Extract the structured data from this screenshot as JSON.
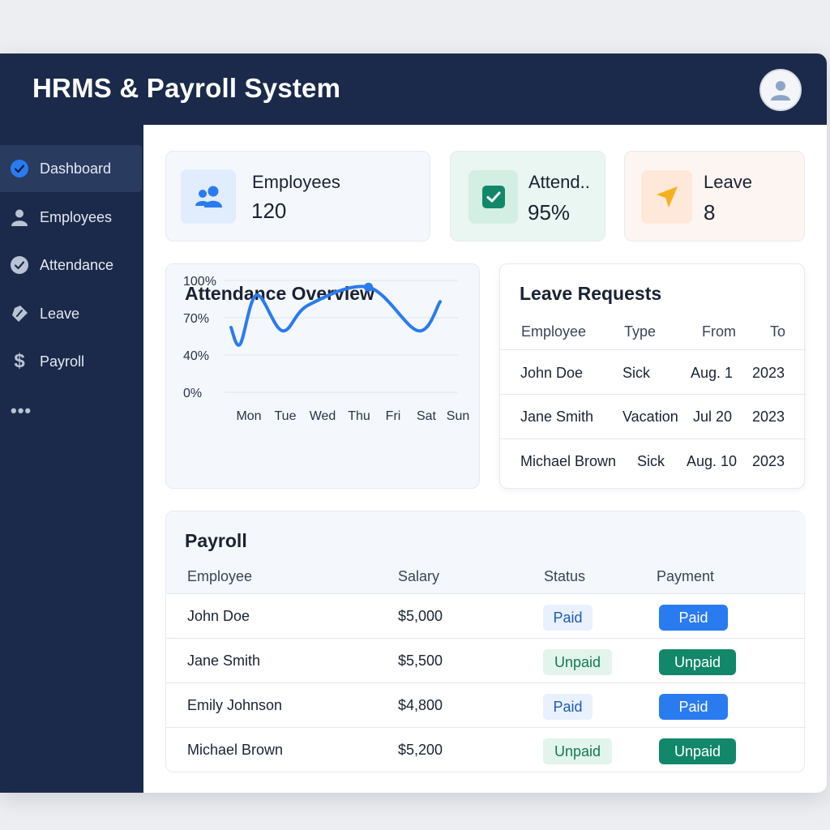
{
  "app": {
    "title": "HRMS & Payroll System"
  },
  "sidebar": {
    "items": [
      {
        "label": "Dashboard",
        "icon": "check-circle-icon",
        "active": true
      },
      {
        "label": "Employees",
        "icon": "user-icon"
      },
      {
        "label": "Attendance",
        "icon": "check-circle-icon"
      },
      {
        "label": "Leave",
        "icon": "tag-icon"
      },
      {
        "label": "Payroll",
        "icon": "dollar-icon"
      }
    ],
    "more": "•••"
  },
  "stats": [
    {
      "label": "Employees",
      "value": "120",
      "icon": "users-icon"
    },
    {
      "label": "Attend..",
      "value": "95%",
      "icon": "checkbox-icon"
    },
    {
      "label": "Leave",
      "value": "8",
      "icon": "send-icon"
    }
  ],
  "attendance": {
    "title": "Attendance Overview",
    "y_ticks": [
      "100%",
      "70%",
      "40%",
      "0%"
    ],
    "x_ticks": [
      "Mon",
      "Tue",
      "Wed",
      "Thu",
      "Fri",
      "Sat",
      "Sun"
    ]
  },
  "chart_data": {
    "type": "line",
    "title": "Attendance Overview",
    "xlabel": "",
    "ylabel": "",
    "categories": [
      "Mon",
      "Tue",
      "Wed",
      "Thu",
      "Fri",
      "Sat",
      "Sun"
    ],
    "y_tick_labels": [
      "100%",
      "70%",
      "40%",
      "0%"
    ],
    "grid": true,
    "series": [
      {
        "values": [
          58,
          43,
          87,
          55,
          78,
          94,
          55,
          81
        ],
        "x_positions": [
          0,
          0.25,
          0.7,
          1.4,
          2.1,
          3.8,
          5.3,
          6.0
        ]
      }
    ],
    "highlight_point": {
      "category": "Fri",
      "value": 94
    },
    "color": "#2a7bf0"
  },
  "leave_requests": {
    "title": "Leave Requests",
    "columns": [
      "Employee",
      "Type",
      "From",
      "To"
    ],
    "rows": [
      [
        "John Doe",
        "Sick",
        "Aug. 1",
        "2023"
      ],
      [
        "Jane Smith",
        "Vacation",
        "Jul 20",
        "2023"
      ],
      [
        "Michael Brown",
        "Sick",
        "Aug. 10",
        "2023"
      ]
    ]
  },
  "payroll": {
    "title": "Payroll",
    "columns": [
      "Employee",
      "Salary",
      "Status",
      "Payment"
    ],
    "rows": [
      {
        "employee": "John Doe",
        "salary": "$5,000",
        "status": "Paid",
        "payment": "Paid"
      },
      {
        "employee": "Jane Smith",
        "salary": "$5,500",
        "status": "Unpaid",
        "payment": "Unpaid"
      },
      {
        "employee": "Emily Johnson",
        "salary": "$4,800",
        "status": "Paid",
        "payment": "Paid"
      },
      {
        "employee": "Michael Brown",
        "salary": "$5,200",
        "status": "Unpaid",
        "payment": "Unpaid"
      }
    ]
  },
  "colors": {
    "navy": "#1b2a4a",
    "accent_blue": "#2a7bf0",
    "paid_bg": "#e8f1fd",
    "paid_text": "#1f5bb5",
    "unpaid_bg": "#e2f4ec",
    "unpaid_text": "#147a57",
    "paid_button": "#2a7bf0",
    "unpaid_button": "#12876a",
    "leave_icon": "#f3b21c"
  }
}
